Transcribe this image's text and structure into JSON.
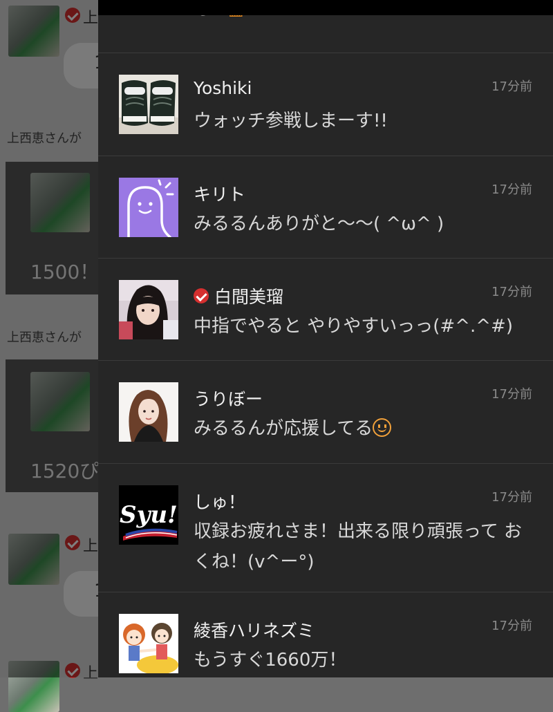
{
  "background_feed": {
    "user_name_fragment": "上",
    "system_line_fragment": "上西恵さんが",
    "card1_text": "1500！",
    "card2_text": "1520ぴ",
    "bubble_fragment": "1"
  },
  "drawer": {
    "partial_top_message": "しか",
    "partial_top_emoji": "▥",
    "notifications": [
      {
        "id": "yoshiki",
        "name": "Yoshiki",
        "verified": false,
        "time": "17分前",
        "message": "ウォッチ参戦しまーす!!",
        "smile": false,
        "avatar_icon": "sneakers-photo-avatar"
      },
      {
        "id": "kirito",
        "name": "キリト",
        "verified": false,
        "time": "17分前",
        "message": "みるるんありがと〜〜( ^ω^ )",
        "smile": false,
        "avatar_icon": "purple-ghost-avatar"
      },
      {
        "id": "shiroma",
        "name": "白間美瑠",
        "verified": true,
        "time": "17分前",
        "message": "中指でやると やりやすいっっ(#^.^#)",
        "smile": false,
        "avatar_icon": "girl-photo-avatar"
      },
      {
        "id": "uribo",
        "name": "うりぼー",
        "verified": false,
        "time": "17分前",
        "message": "みるるんが応援してる",
        "smile": true,
        "avatar_icon": "portrait-photo-avatar"
      },
      {
        "id": "syu",
        "name": "しゅ！",
        "verified": false,
        "time": "17分前",
        "message": "収録お疲れさま！出来る限り頑張って おくね！(v^ー°)",
        "smile": false,
        "avatar_icon": "syu-logo-avatar",
        "avatar_text": "Syu!"
      },
      {
        "id": "ayaka",
        "name": "綾香ハリネズミ",
        "verified": false,
        "time": "17分前",
        "message": "もうすぐ1660万！",
        "smile": false,
        "avatar_icon": "cartoon-kids-avatar"
      }
    ]
  },
  "colors": {
    "drawer_bg": "#262626",
    "verified_badge": "#d42f2f",
    "timestamp": "#8a8a8a",
    "emoji_orange": "#f2a13a"
  }
}
